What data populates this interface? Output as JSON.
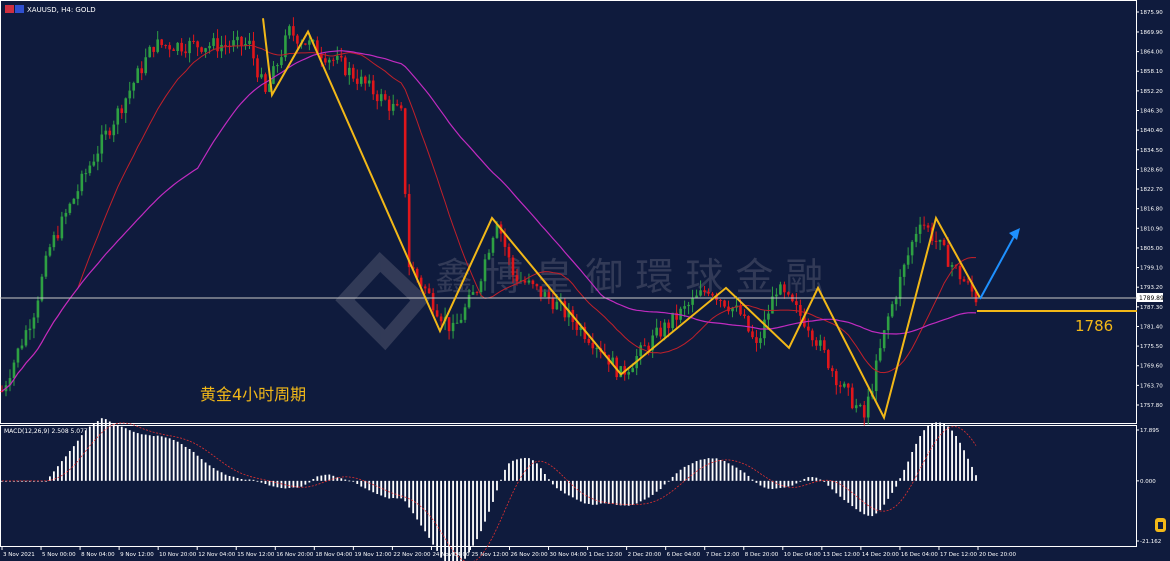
{
  "header": {
    "symbol_text": "XAUUSD, H4:  GOLD"
  },
  "annotation": {
    "title_cn": "黄金4小时周期",
    "level_label": "1786",
    "watermark": "鑫 博 皇 御 環 球 金 融"
  },
  "macd": {
    "label": "MACD(12,26,9) 2.508 5.077"
  },
  "colors": {
    "background": "#0f1b3d",
    "bull": "#2ea043",
    "bear": "#e0161b",
    "ma_fast": "#c0202a",
    "ma_slow": "#c02bc0",
    "zigzag": "#f2b818",
    "arrow": "#1e90ff",
    "level_line": "#f2b818",
    "price_line": "#c8c8c8"
  },
  "chart_data": [
    {
      "type": "candlestick",
      "y_axis_ticks": [
        "1875.90",
        "1869.90",
        "1864.00",
        "1858.10",
        "1852.20",
        "1846.30",
        "1840.40",
        "1834.50",
        "1828.60",
        "1822.70",
        "1816.80",
        "1810.90",
        "1805.00",
        "1799.10",
        "1793.20",
        "1787.30",
        "1781.40",
        "1775.50",
        "1769.60",
        "1763.70",
        "1757.80"
      ],
      "x_axis_labels": [
        "3 Nov 2021",
        "5 Nov 00:00",
        "8 Nov 04:00",
        "9 Nov 12:00",
        "10 Nov 20:00",
        "12 Nov 04:00",
        "15 Nov 12:00",
        "16 Nov 20:00",
        "18 Nov 04:00",
        "19 Nov 12:00",
        "22 Nov 20:00",
        "24 Nov 04:00",
        "25 Nov 12:00",
        "26 Nov 20:00",
        "30 Nov 04:00",
        "1 Dec 12:00",
        "2 Dec 20:00",
        "6 Dec 04:00",
        "7 Dec 12:00",
        "8 Dec 20:00",
        "10 Dec 04:00",
        "13 Dec 12:00",
        "14 Dec 20:00",
        "16 Dec 04:00",
        "17 Dec 12:00",
        "20 Dec 20:00"
      ],
      "ylim": [
        1753,
        1878
      ],
      "current_price": "1789.89",
      "key_level": 1786,
      "zigzag": [
        {
          "x": "15 Nov 12:00",
          "y": 1874
        },
        {
          "x": "16 Nov",
          "y": 1851
        },
        {
          "x": "17 Nov",
          "y": 1870
        },
        {
          "x": "23 Nov",
          "y": 1780
        },
        {
          "x": "25 Nov 12:00",
          "y": 1814
        },
        {
          "x": "1 Dec 12:00",
          "y": 1767
        },
        {
          "x": "7 Dec",
          "y": 1793
        },
        {
          "x": "9 Dec",
          "y": 1775
        },
        {
          "x": "10 Dec",
          "y": 1793
        },
        {
          "x": "14 Dec 12:00",
          "y": 1754
        },
        {
          "x": "16 Dec 12:00",
          "y": 1814
        },
        {
          "x": "20 Dec 20:00",
          "y": 1790
        }
      ],
      "projection": {
        "from": 1790,
        "to": 1809
      }
    },
    {
      "type": "bar",
      "name": "MACD",
      "y_axis_ticks": [
        "17.895",
        "0.000",
        "-21.162"
      ],
      "ylim": [
        -21.162,
        17.895
      ]
    }
  ]
}
